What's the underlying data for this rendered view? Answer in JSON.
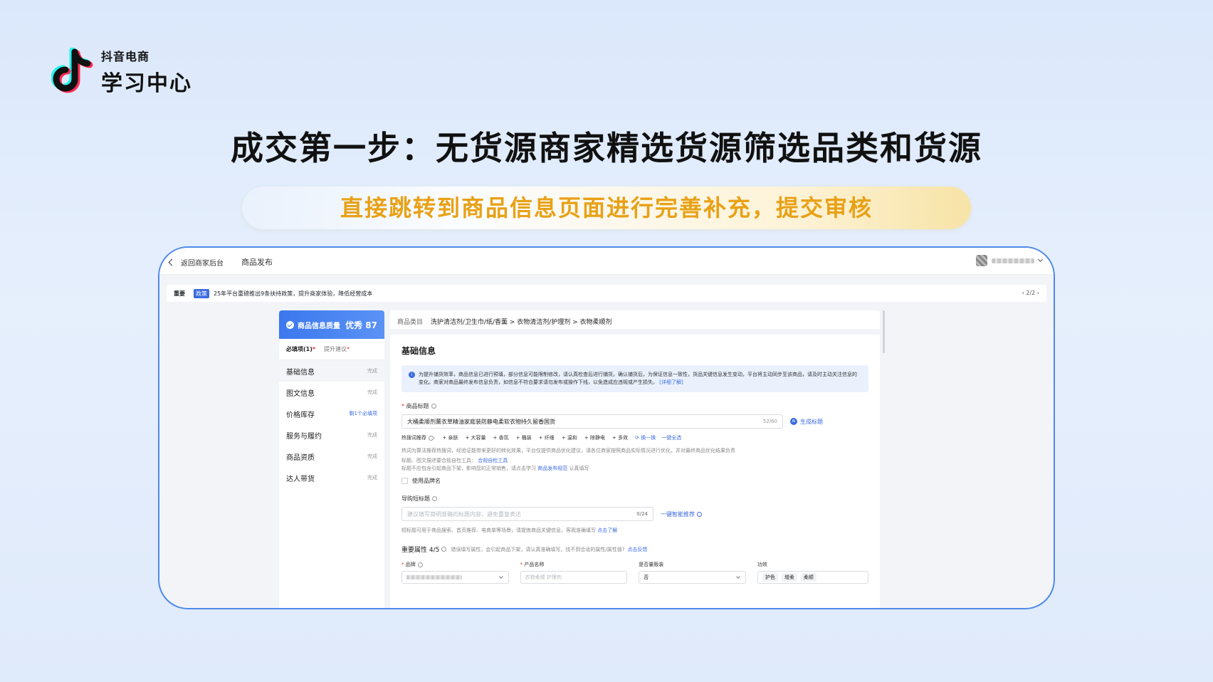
{
  "brand": {
    "sub": "抖音电商",
    "main": "学习中心",
    "icon": "tiktok-note-icon"
  },
  "headline": "成交第一步：无货源商家精选货源筛选品类和货源",
  "subtitle": "直接跳转到商品信息页面进行完善补充，提交审核",
  "app": {
    "back_label": "返回商家后台",
    "page_title": "商品发布",
    "notice": {
      "tag": "重要",
      "badge": "政策",
      "text": "25年平台重磅推出9条扶持政策，提升商家体验，降低经营成本",
      "page": "2/2"
    },
    "sidebar": {
      "score_label": "商品信息质量",
      "score_value": "优秀 87",
      "tab_required": "必填项(1)",
      "tab_suggest": "提升建议",
      "items": [
        {
          "label": "基础信息",
          "status": "完成"
        },
        {
          "label": "图文信息",
          "status": "完成"
        },
        {
          "label": "价格库存",
          "status": "剩1个必填项"
        },
        {
          "label": "服务与履约",
          "status": "完成"
        },
        {
          "label": "商品资质",
          "status": "完成"
        },
        {
          "label": "达人带货",
          "status": "完成"
        }
      ]
    },
    "breadcrumb": {
      "label": "商品类目",
      "path": "洗护清洁剂/卫生巾/纸/香薰 > 衣物清洁剂/护理剂 > 衣物柔顺剂"
    },
    "form": {
      "section_title": "基础信息",
      "info_text": "为提升铺货效率，商品信息已进行预填，部分信息可能限制修改，请认真检查后进行铺货。确认铺货后，为保证信息一致性，货品关键信息发生变动，平台将主动同步至该商品，请及时主动关注信息的变化。商家对商品最终发布信息负责，如信息不符合要求请勿发布或操作下线，以免造成应违规或产生损失。",
      "info_link": "[详细了解]",
      "title_label": "商品标题",
      "title_value": "大桶柔顺剂薰衣草精油家庭装防静电柔软衣物持久留香国货",
      "title_count": "52/60",
      "ai_button": "生成标题",
      "hot_label": "热搜词推荐",
      "hot_words": [
        "亲肤",
        "大容量",
        "香氛",
        "桶装",
        "纤维",
        "温和",
        "除静电",
        "多效"
      ],
      "refresh": "换一换",
      "select_all": "一键全选",
      "hot_note": "热词为算法推荐热搜词，经验证能带来更好的转化效果，平台仅提供商品优化建议，请各位商家按照商品实际情况进行优化，并对最终商品优化结果负责",
      "note2_prefix": "标题、图文描述要合规自检工具：",
      "note2_link": "合规自检工具",
      "note3_prefix": "标题不应包含引起商品下架、影响您的正常销售，请点击学习",
      "note3_link": "商品发布规范",
      "note3_suffix": "认真填写",
      "brand_checkbox": "使用品牌名",
      "short_title_label": "导购短标题",
      "short_title_placeholder": "建议填写简明准确的标题内容，避免重复表达",
      "short_title_count": "0/24",
      "smart_button": "一键智能推荐",
      "short_note": "短标题可用于商品搜索、首页推荐、电商单等场景，请提炼商品关键信息，客观准确填写",
      "short_link": "点击了解",
      "attr_title": "重要属性 4/5",
      "attr_hint": "错误填写属性，会引起商品下架，请认真准确填写。找不到合适的属性/属性值?",
      "attr_link": "点击反馈",
      "attrs": {
        "brand_label": "品牌",
        "product_label": "产品名称",
        "product_placeholder": "衣物柔顺 护理剂",
        "quantity_label": "是否量贩装",
        "quantity_value": "否",
        "effect_label": "功效",
        "effect_tags": [
          "护色",
          "增柔",
          "柔顺"
        ]
      }
    },
    "colors": {
      "accent": "#3b6be0",
      "frame": "#4f8ae8",
      "highlight": "#e8a116"
    }
  }
}
